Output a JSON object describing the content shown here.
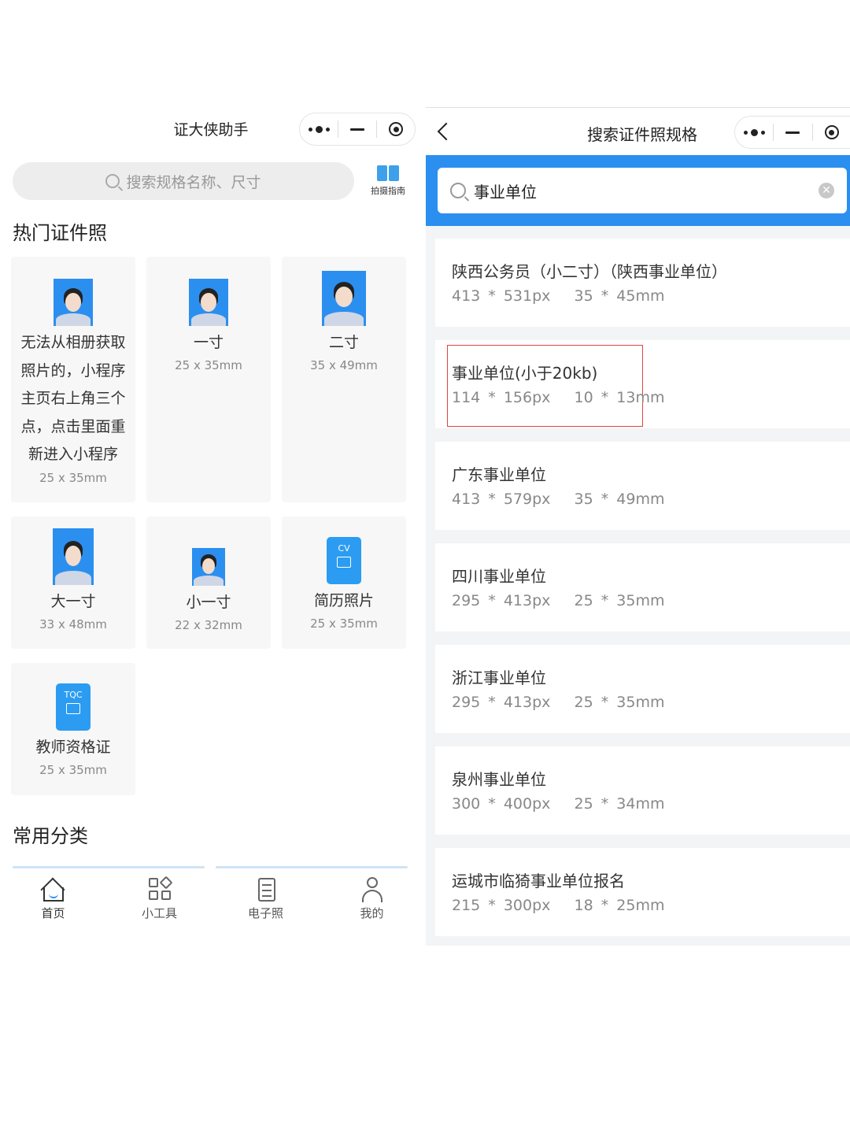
{
  "left": {
    "title": "证大侠助手",
    "search_placeholder": "搜索规格名称、尺寸",
    "guide_label": "拍摄指南",
    "hot_heading": "热门证件照",
    "common_heading": "常用分类",
    "cards": [
      {
        "name": "无法从相册获取照片的，小程序主页右上角三个点，点击里面重新进入小程序",
        "size": "25 x 35mm",
        "icon": "portrait-icon"
      },
      {
        "name": "一寸",
        "size": "25 x 35mm",
        "icon": "portrait-icon"
      },
      {
        "name": "二寸",
        "size": "35 x 49mm",
        "icon": "portrait-icon"
      },
      {
        "name": "大一寸",
        "size": "33 x 48mm",
        "icon": "portrait-icon"
      },
      {
        "name": "小一寸",
        "size": "22 x 32mm",
        "icon": "portrait-icon"
      },
      {
        "name": "简历照片",
        "size": "25 x 35mm",
        "icon": "resume-icon",
        "badge": "CV"
      },
      {
        "name": "教师资格证",
        "size": "25 x 35mm",
        "icon": "teacher-cert-icon",
        "badge": "TQC"
      }
    ],
    "tabs": [
      {
        "label": "首页",
        "icon": "home-icon"
      },
      {
        "label": "小工具",
        "icon": "tools-icon"
      },
      {
        "label": "电子照",
        "icon": "document-icon"
      },
      {
        "label": "我的",
        "icon": "user-icon"
      }
    ]
  },
  "right": {
    "title": "搜索证件照规格",
    "search_value": "事业单位",
    "results": [
      {
        "name": "陕西公务员（小二寸）（陕西事业单位）",
        "px": "413 * 531px",
        "mm": "35 * 45mm"
      },
      {
        "name": "事业单位(小于20kb)",
        "px": "114 * 156px",
        "mm": "10 * 13mm",
        "highlighted": true
      },
      {
        "name": "广东事业单位",
        "px": "413 * 579px",
        "mm": "35 * 49mm"
      },
      {
        "name": "四川事业单位",
        "px": "295 * 413px",
        "mm": "25 * 35mm"
      },
      {
        "name": "浙江事业单位",
        "px": "295 * 413px",
        "mm": "25 * 35mm"
      },
      {
        "name": "泉州事业单位",
        "px": "300 * 400px",
        "mm": "25 * 34mm"
      },
      {
        "name": "运城市临猗事业单位报名",
        "px": "215 * 300px",
        "mm": "18 * 25mm"
      }
    ]
  },
  "colors": {
    "accent": "#2b8ff0",
    "highlight_border": "#e0453e",
    "card_bg": "#f7f7f7"
  }
}
